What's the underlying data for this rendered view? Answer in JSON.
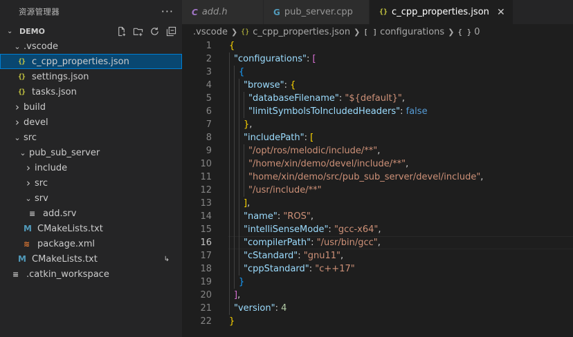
{
  "sidebar": {
    "title": "资源管理器",
    "more": "···",
    "section": "DEMO",
    "tree": [
      {
        "label": ".vscode",
        "type": "folder",
        "open": true,
        "depth": 1
      },
      {
        "label": "c_cpp_properties.json",
        "type": "json",
        "depth": 2,
        "selected": true
      },
      {
        "label": "settings.json",
        "type": "json",
        "depth": 2
      },
      {
        "label": "tasks.json",
        "type": "json",
        "depth": 2
      },
      {
        "label": "build",
        "type": "folder",
        "open": false,
        "depth": 1
      },
      {
        "label": "devel",
        "type": "folder",
        "open": false,
        "depth": 1
      },
      {
        "label": "src",
        "type": "folder",
        "open": true,
        "depth": 1
      },
      {
        "label": "pub_sub_server",
        "type": "folder",
        "open": true,
        "depth": 2
      },
      {
        "label": "include",
        "type": "folder",
        "open": false,
        "depth": 3
      },
      {
        "label": "src",
        "type": "folder",
        "open": false,
        "depth": 3
      },
      {
        "label": "srv",
        "type": "folder",
        "open": true,
        "depth": 3
      },
      {
        "label": "add.srv",
        "type": "lines",
        "depth": 4
      },
      {
        "label": "CMakeLists.txt",
        "type": "cmake",
        "depth": 3
      },
      {
        "label": "package.xml",
        "type": "rss",
        "depth": 3
      },
      {
        "label": "CMakeLists.txt",
        "type": "cmake",
        "depth": 2,
        "badge": "↳"
      },
      {
        "label": ".catkin_workspace",
        "type": "lines",
        "depth": 1
      }
    ]
  },
  "tabs": [
    {
      "label": "add.h",
      "icon": "C",
      "kind": "c",
      "italic": true,
      "state": "none"
    },
    {
      "label": "pub_server.cpp",
      "icon": "G",
      "kind": "cpp",
      "italic": false,
      "state": "dirty"
    },
    {
      "label": "c_cpp_properties.json",
      "icon": "{}",
      "kind": "json",
      "italic": false,
      "state": "close",
      "active": true
    }
  ],
  "breadcrumb": {
    "folder": ".vscode",
    "file": "c_cpp_properties.json",
    "key": "configurations",
    "index": "0",
    "array_icon": "[ ]",
    "object_icon": "{ }",
    "file_icon": "{}"
  },
  "editor": {
    "current_line": 16,
    "lines": [
      {
        "n": "1",
        "indent": 0,
        "tokens": [
          [
            "b1",
            "{"
          ]
        ]
      },
      {
        "n": "2",
        "indent": 1,
        "tokens": [
          [
            "k",
            "\"configurations\""
          ],
          [
            "p",
            ": "
          ],
          [
            "b2",
            "["
          ]
        ]
      },
      {
        "n": "3",
        "indent": 2,
        "tokens": [
          [
            "b3",
            "{"
          ]
        ]
      },
      {
        "n": "4",
        "indent": 3,
        "tokens": [
          [
            "k",
            "\"browse\""
          ],
          [
            "p",
            ": "
          ],
          [
            "b1",
            "{"
          ]
        ]
      },
      {
        "n": "5",
        "indent": 4,
        "tokens": [
          [
            "k",
            "\"databaseFilename\""
          ],
          [
            "p",
            ": "
          ],
          [
            "s",
            "\"${default}\""
          ],
          [
            "p",
            ","
          ]
        ]
      },
      {
        "n": "6",
        "indent": 4,
        "tokens": [
          [
            "k",
            "\"limitSymbolsToIncludedHeaders\""
          ],
          [
            "p",
            ": "
          ],
          [
            "bool",
            "false"
          ]
        ]
      },
      {
        "n": "7",
        "indent": 3,
        "tokens": [
          [
            "b1",
            "}"
          ],
          [
            "p",
            ","
          ]
        ]
      },
      {
        "n": "8",
        "indent": 3,
        "tokens": [
          [
            "k",
            "\"includePath\""
          ],
          [
            "p",
            ": "
          ],
          [
            "b1",
            "["
          ]
        ]
      },
      {
        "n": "9",
        "indent": 4,
        "tokens": [
          [
            "s",
            "\"/opt/ros/melodic/include/**\""
          ],
          [
            "p",
            ","
          ]
        ]
      },
      {
        "n": "10",
        "indent": 4,
        "tokens": [
          [
            "s",
            "\"/home/xin/demo/devel/include/**\""
          ],
          [
            "p",
            ","
          ]
        ]
      },
      {
        "n": "11",
        "indent": 4,
        "tokens": [
          [
            "s",
            "\"home/xin/demo/src/pub_sub_server/devel/include\""
          ],
          [
            "p",
            ","
          ]
        ]
      },
      {
        "n": "12",
        "indent": 4,
        "tokens": [
          [
            "s",
            "\"/usr/include/**\""
          ]
        ]
      },
      {
        "n": "13",
        "indent": 3,
        "tokens": [
          [
            "b1",
            "]"
          ],
          [
            "p",
            ","
          ]
        ]
      },
      {
        "n": "14",
        "indent": 3,
        "tokens": [
          [
            "k",
            "\"name\""
          ],
          [
            "p",
            ": "
          ],
          [
            "s",
            "\"ROS\""
          ],
          [
            "p",
            ","
          ]
        ]
      },
      {
        "n": "15",
        "indent": 3,
        "tokens": [
          [
            "k",
            "\"intelliSenseMode\""
          ],
          [
            "p",
            ": "
          ],
          [
            "s",
            "\"gcc-x64\""
          ],
          [
            "p",
            ","
          ]
        ]
      },
      {
        "n": "16",
        "indent": 3,
        "tokens": [
          [
            "k",
            "\"compilerPath\""
          ],
          [
            "p",
            ": "
          ],
          [
            "s",
            "\"/usr/bin/gcc\""
          ],
          [
            "p",
            ","
          ]
        ]
      },
      {
        "n": "17",
        "indent": 3,
        "tokens": [
          [
            "k",
            "\"cStandard\""
          ],
          [
            "p",
            ": "
          ],
          [
            "s",
            "\"gnu11\""
          ],
          [
            "p",
            ","
          ]
        ]
      },
      {
        "n": "18",
        "indent": 3,
        "tokens": [
          [
            "k",
            "\"cppStandard\""
          ],
          [
            "p",
            ": "
          ],
          [
            "s",
            "\"c++17\""
          ]
        ]
      },
      {
        "n": "19",
        "indent": 2,
        "tokens": [
          [
            "b3",
            "}"
          ]
        ]
      },
      {
        "n": "20",
        "indent": 1,
        "tokens": [
          [
            "b2",
            "]"
          ],
          [
            "p",
            ","
          ]
        ]
      },
      {
        "n": "21",
        "indent": 1,
        "tokens": [
          [
            "k",
            "\"version\""
          ],
          [
            "p",
            ": "
          ],
          [
            "num",
            "4"
          ]
        ]
      },
      {
        "n": "22",
        "indent": 0,
        "tokens": [
          [
            "b1",
            "}"
          ]
        ]
      }
    ]
  },
  "colors": {
    "key": "#9cdcfe",
    "string": "#ce9178",
    "bracket_gold": "#ffd700",
    "bracket_purple": "#da70d6",
    "bracket_blue": "#179fff",
    "boolean": "#569cd6",
    "number": "#b5cea8",
    "selection": "#094771"
  }
}
